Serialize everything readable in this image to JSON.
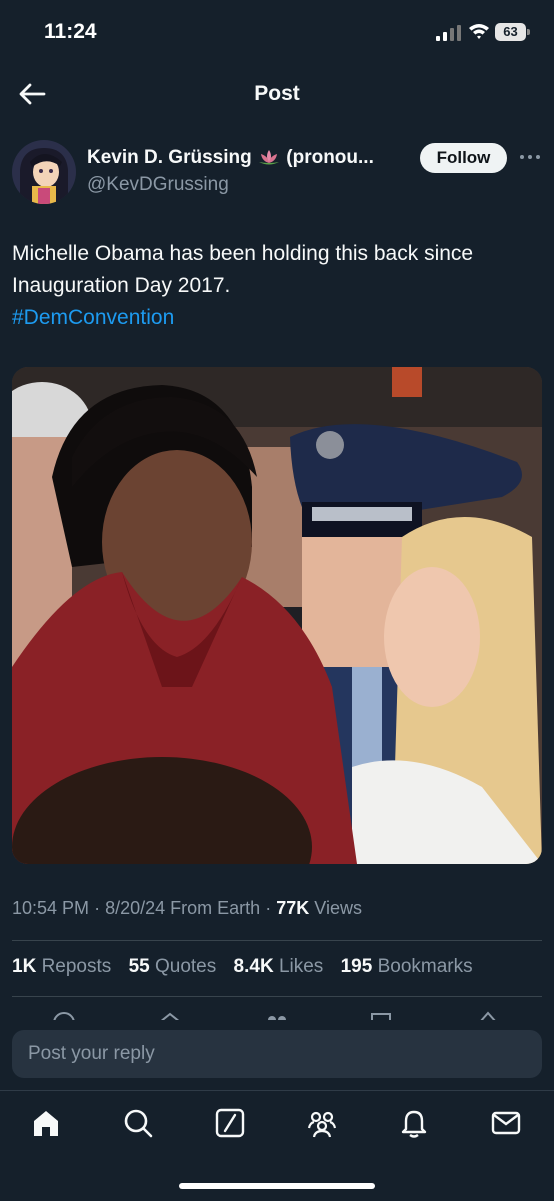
{
  "status_bar": {
    "time": "11:24",
    "battery": "63"
  },
  "header": {
    "title": "Post"
  },
  "author": {
    "display_name": "Kevin D. Grüssing",
    "name_suffix": "(pronou...",
    "handle": "@KevDGrussing"
  },
  "follow_label": "Follow",
  "tweet": {
    "text": "Michelle Obama has been holding this back since Inauguration Day 2017.",
    "hashtag": "#DemConvention"
  },
  "meta": {
    "time": "10:54 PM",
    "date": "8/20/24",
    "source": "From Earth",
    "views_count": "77K",
    "views_label": "Views"
  },
  "stats": {
    "reposts_count": "1K",
    "reposts_label": "Reposts",
    "quotes_count": "55",
    "quotes_label": "Quotes",
    "likes_count": "8.4K",
    "likes_label": "Likes",
    "bookmarks_count": "195",
    "bookmarks_label": "Bookmarks"
  },
  "reply": {
    "placeholder": "Post your reply"
  },
  "colors": {
    "background": "#15202b",
    "accent": "#1d9bf0",
    "muted": "#8b98a5",
    "follow_bg": "#eff3f4"
  },
  "icons": {
    "nav": "back-arrow-icon",
    "tabs": [
      "home-icon",
      "search-icon",
      "grok-icon",
      "communities-icon",
      "notifications-icon",
      "messages-icon"
    ]
  }
}
